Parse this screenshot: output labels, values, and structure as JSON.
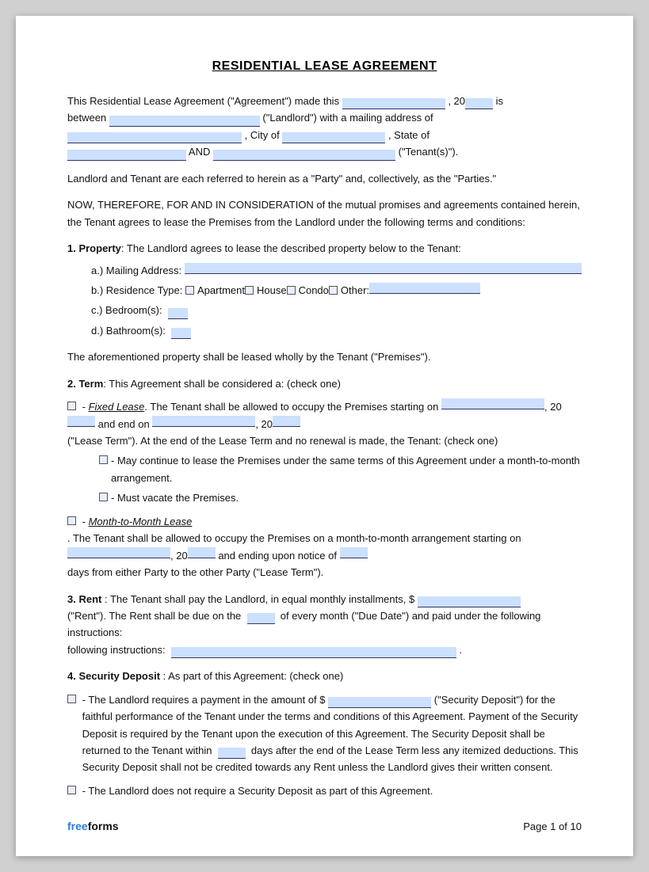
{
  "title": "RESIDENTIAL LEASE AGREEMENT",
  "intro": {
    "line1_pre": "This Residential Lease Agreement (\"Agreement\") made this",
    "line1_mid": ", 20",
    "line1_post": "is",
    "line2_pre": "between",
    "line2_mid": "(\"Landlord\") with a mailing address of",
    "line3_pre": "",
    "line3_city": ", City of",
    "line3_state": ", State of",
    "line4_and": "AND",
    "line4_post": "(\"Tenant(s)\")."
  },
  "party_note": "Landlord and Tenant are each referred to herein as a \"Party\" and, collectively, as the \"Parties.\"",
  "consideration": "NOW, THEREFORE, FOR AND IN CONSIDERATION of the mutual promises and agreements contained herein, the Tenant agrees to lease the Premises from the Landlord under the following terms and conditions:",
  "section1": {
    "heading": "1. Property",
    "text": ": The Landlord agrees to lease the described property below to the Tenant:",
    "a_label": "a.)  Mailing Address:",
    "b_label": "b.)  Residence Type:",
    "b_options": [
      "Apartment",
      "House",
      "Condo",
      "Other:"
    ],
    "c_label": "c.)  Bedroom(s):",
    "d_label": "d.)  Bathroom(s):",
    "closing": "The aforementioned property shall be leased wholly by the Tenant (\"Premises\")."
  },
  "section2": {
    "heading": "2. Term",
    "text": ": This Agreement shall be considered a: (check one)",
    "fixed_lease": {
      "label": "Fixed Lease",
      "text1": ". The Tenant shall be allowed to occupy the Premises starting on",
      "text2": ", 20",
      "text3": "and end on",
      "text4": ", 20",
      "text5": "(\"Lease Term\"). At the end of the Lease Term and no renewal is made, the Tenant: (check one)",
      "sub1": "- May continue to lease the Premises under the same terms of this Agreement under a month-to-month arrangement.",
      "sub2": "- Must vacate the Premises."
    },
    "month_lease": {
      "label": "Month-to-Month Lease",
      "text1": ". The Tenant shall be allowed to occupy the Premises on a month-to-month arrangement starting on",
      "text2": ", 20",
      "text3": "and ending upon notice of",
      "text4": "days from either Party to the other Party (\"Lease Term\")."
    }
  },
  "section3": {
    "heading": "3. Rent",
    "text1": ": The Tenant shall pay the Landlord, in equal monthly installments, $",
    "text2": "(\"Rent\"). The Rent shall be due on the",
    "text3": "of every month (\"Due Date\") and paid under the following instructions:",
    "text4": "."
  },
  "section4": {
    "heading": "4. Security Deposit",
    "text": ": As part of this Agreement: (check one)",
    "option1_pre": "- The Landlord requires a payment in the amount of $",
    "option1_post": "(\"Security Deposit\") for the faithful performance of the Tenant under the terms and conditions of this Agreement. Payment of the Security Deposit is required by the Tenant upon the execution of this Agreement. The Security Deposit shall be returned to the Tenant within",
    "option1_days": "days after the end of the Lease Term less any itemized deductions. This Security Deposit shall not be credited towards any Rent unless the Landlord gives their written consent.",
    "option2": "- The Landlord does not require a Security Deposit as part of this Agreement."
  },
  "footer": {
    "free": "free",
    "forms": "forms",
    "page": "Page 1 of 10"
  }
}
